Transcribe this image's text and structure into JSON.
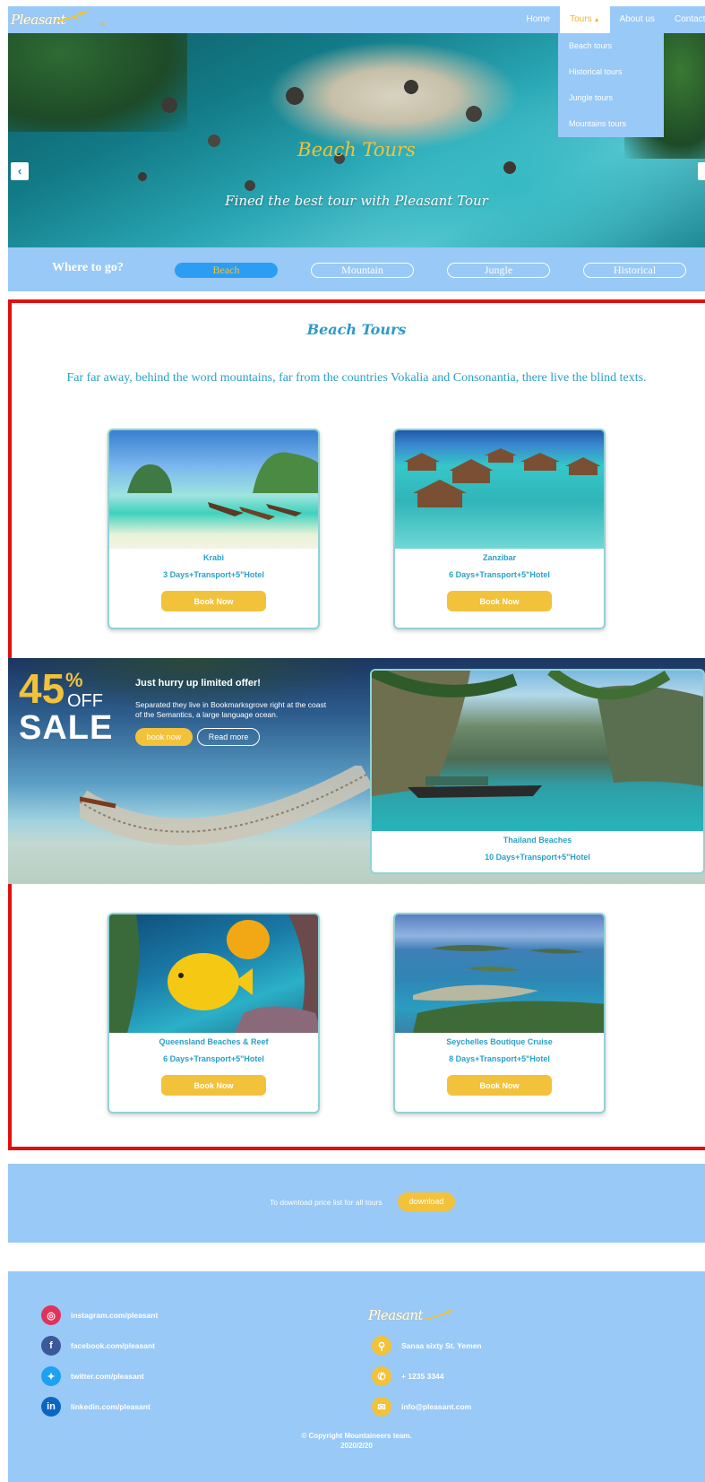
{
  "nav": {
    "logo_text": "Pleasant",
    "logo_sub": "co",
    "links": [
      {
        "label": "Home"
      },
      {
        "label": "Tours"
      },
      {
        "label": "About us"
      },
      {
        "label": "Contact us"
      }
    ],
    "dropdown": [
      "Beach tours",
      "Historical tours",
      "Jungle tours",
      "Mountains tours"
    ]
  },
  "hero": {
    "title": "Beach Tours",
    "subtitle": "Fined the best tour with Pleasant Tour"
  },
  "filter": {
    "label": "Where to go?",
    "options": [
      "Beach",
      "Mountain",
      "Jungle",
      "Historical"
    ],
    "selected": "Beach"
  },
  "section": {
    "title": "Beach Tours",
    "description": "Far far away, behind the word mountains, far from the countries Vokalia and Consonantia, there live the blind texts."
  },
  "cards": [
    {
      "name": "Krabi",
      "info": "3 Days+Transport+5\"Hotel",
      "button": "Book Now"
    },
    {
      "name": "Zanzibar",
      "info": "6 Days+Transport+5\"Hotel",
      "button": "Book Now"
    },
    {
      "name": "Queensland Beaches & Reef",
      "info": "6 Days+Transport+5\"Hotel",
      "button": "Book Now"
    },
    {
      "name": "Seychelles Boutique Cruise",
      "info": "8 Days+Transport+5\"Hotel",
      "button": "Book Now"
    }
  ],
  "offer": {
    "percent": "45",
    "percent_sign": "%",
    "off": "OFF",
    "sale": "SALE",
    "title": "Just hurry up limited offer!",
    "text": "Separated they live in Bookmarksgrove right at the coast of the Semantics, a large language ocean.",
    "book_label": "book now",
    "read_label": "Read more",
    "feature": {
      "name": "Thailand Beaches",
      "info": "10 Days+Transport+5\"Hotel"
    }
  },
  "download": {
    "text": "To download price list for all tours",
    "button": "download"
  },
  "footer": {
    "social": [
      {
        "icon": "instagram-icon",
        "text": "instagram.com/pleasant"
      },
      {
        "icon": "facebook-icon",
        "text": "facebook.com/pleasant"
      },
      {
        "icon": "twitter-icon",
        "text": "twitter.com/pleasant"
      },
      {
        "icon": "linkedin-icon",
        "text": "linkedin.com/pleasant"
      }
    ],
    "logo_text": "Pleasant",
    "contact": [
      {
        "icon": "location-icon",
        "text": "Sanaa sixty St. Yemen"
      },
      {
        "icon": "phone-icon",
        "text": "+ 1235 3344"
      },
      {
        "icon": "mail-icon",
        "text": "info@pleasant.com"
      }
    ],
    "copyright": "© Copyright Mountaineers team.",
    "year": "2020/2/20"
  },
  "colors": {
    "nav_bg": "#99c9f7",
    "accent": "#f2c23a",
    "text_blue": "#2aa0c8",
    "highlight_border": "#e01010"
  }
}
